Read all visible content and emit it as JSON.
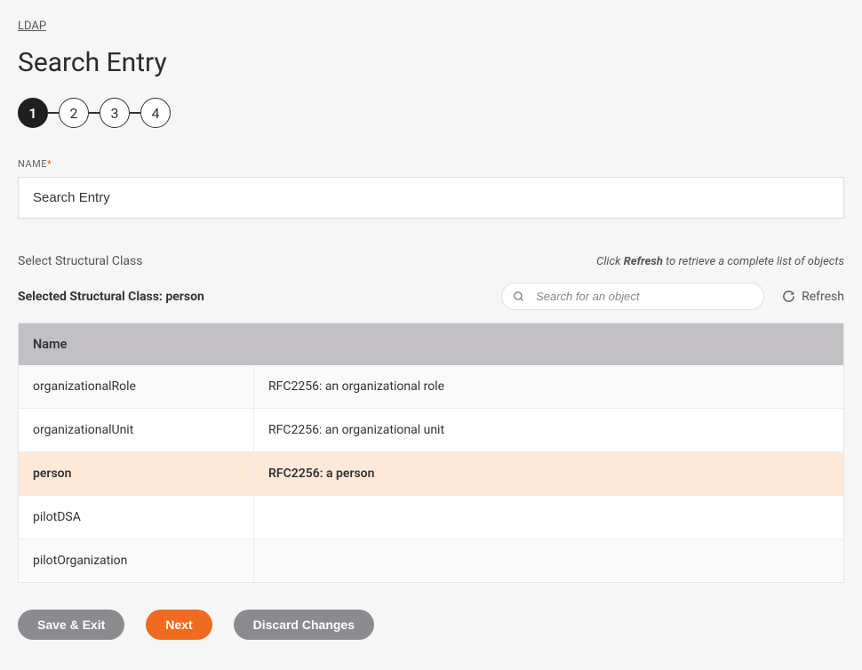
{
  "breadcrumb": "LDAP",
  "page_title": "Search Entry",
  "stepper": [
    "1",
    "2",
    "3",
    "4"
  ],
  "active_step": 0,
  "name_field": {
    "label": "NAME",
    "required": "*",
    "value": "Search Entry"
  },
  "section": {
    "label": "Select Structural Class",
    "hint_prefix": "Click ",
    "hint_bold": "Refresh",
    "hint_suffix": " to retrieve a complete list of objects"
  },
  "selected": {
    "prefix": "Selected Structural Class: ",
    "value": "person"
  },
  "search": {
    "placeholder": "Search for an object"
  },
  "refresh_label": "Refresh",
  "table": {
    "header": "Name",
    "rows": [
      {
        "name": "organizationalRole",
        "desc": "RFC2256: an organizational role",
        "selected": false
      },
      {
        "name": "organizationalUnit",
        "desc": "RFC2256: an organizational unit",
        "selected": false
      },
      {
        "name": "person",
        "desc": "RFC2256: a person",
        "selected": true
      },
      {
        "name": "pilotDSA",
        "desc": "",
        "selected": false
      },
      {
        "name": "pilotOrganization",
        "desc": "",
        "selected": false
      }
    ]
  },
  "footer": {
    "save": "Save & Exit",
    "next": "Next",
    "discard": "Discard Changes"
  }
}
